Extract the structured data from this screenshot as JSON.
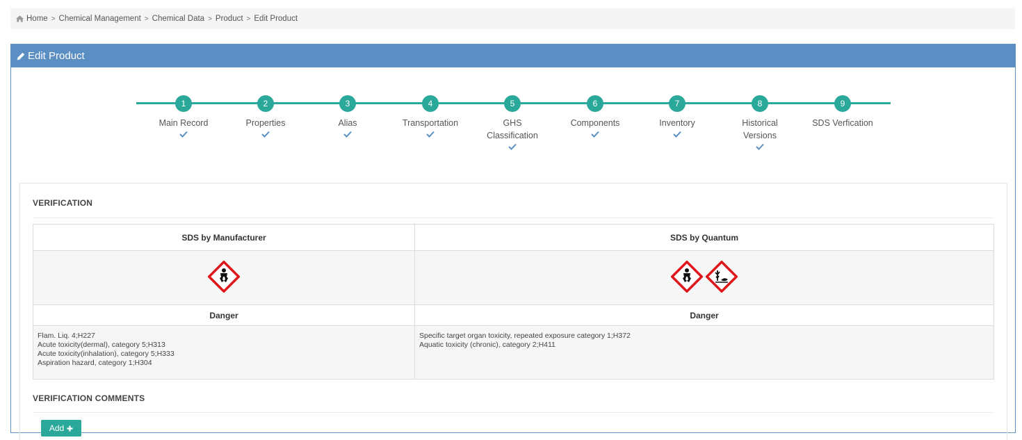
{
  "breadcrumb": {
    "items": [
      "Home",
      "Chemical Management",
      "Chemical Data",
      "Product",
      "Edit Product"
    ],
    "separator": ">"
  },
  "panel": {
    "title": "Edit Product",
    "header_color": "#5b8fc4"
  },
  "wizard": {
    "accent_color": "#2aa89a",
    "steps": [
      {
        "number": "1",
        "label": "Main Record",
        "checked": true
      },
      {
        "number": "2",
        "label": "Properties",
        "checked": true
      },
      {
        "number": "3",
        "label": "Alias",
        "checked": true
      },
      {
        "number": "4",
        "label": "Transportation",
        "checked": true
      },
      {
        "number": "5",
        "label": "GHS Classification",
        "checked": true
      },
      {
        "number": "6",
        "label": "Components",
        "checked": true
      },
      {
        "number": "7",
        "label": "Inventory",
        "checked": true
      },
      {
        "number": "8",
        "label": "Historical Versions",
        "checked": true
      },
      {
        "number": "9",
        "label": "SDS Verfication",
        "checked": false
      }
    ]
  },
  "verification": {
    "title": "VERIFICATION",
    "manufacturer": {
      "header": "SDS by Manufacturer",
      "pictograms": [
        "health-hazard-icon"
      ],
      "signal_word": "Danger",
      "hazard_statements": [
        "Flam. Liq. 4;H227",
        "Acute toxicity(dermal), category 5;H313",
        "Acute toxicity(inhalation), category 5;H333",
        "Aspiration hazard, category 1;H304"
      ]
    },
    "quantum": {
      "header": "SDS by Quantum",
      "pictograms": [
        "health-hazard-icon",
        "environment-hazard-icon"
      ],
      "signal_word": "Danger",
      "hazard_statements": [
        "Specific target organ toxicity, repeated exposure category 1;H372",
        "Aquatic toxicity (chronic), category 2;H411"
      ]
    }
  },
  "comments": {
    "title": "VERIFICATION COMMENTS",
    "add_label": "Add"
  }
}
